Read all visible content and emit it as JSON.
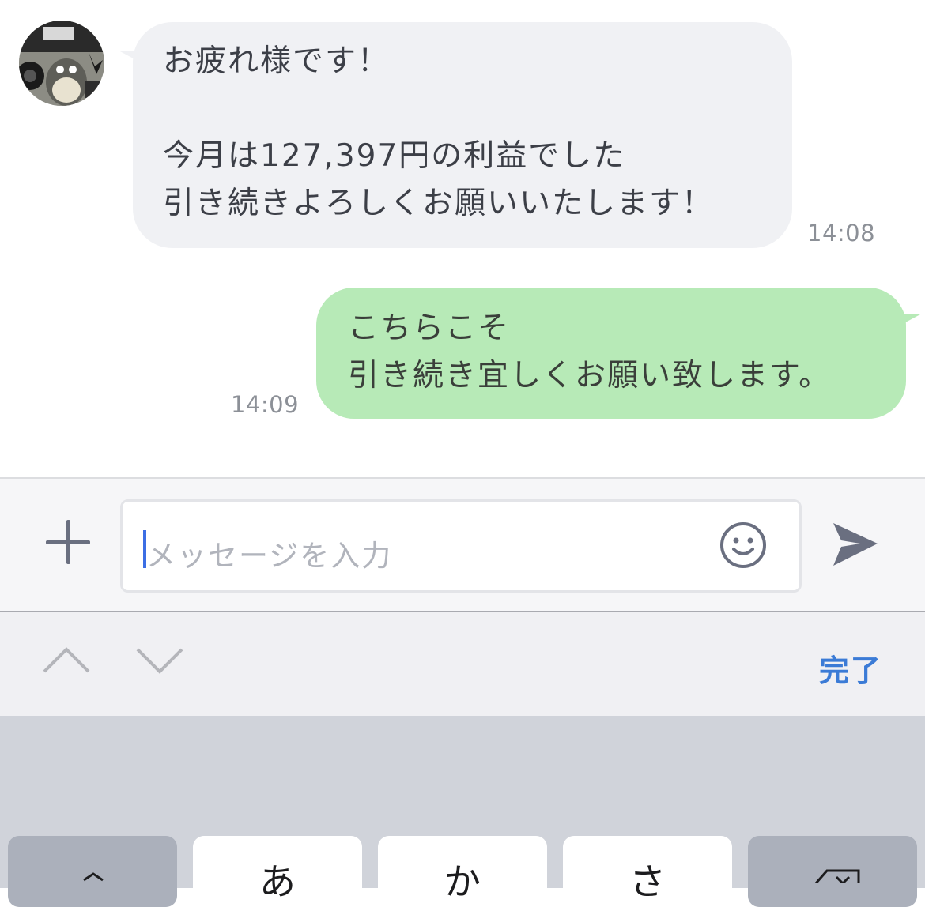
{
  "chat": {
    "incoming": {
      "lines": [
        "お疲れ様です！",
        "",
        "今月は127,397円の利益でした",
        "引き続きよろしくお願いいたします！"
      ],
      "time": "14:08"
    },
    "outgoing": {
      "lines": [
        "こちらこそ",
        "引き続き宜しくお願い致します。"
      ],
      "time": "14:09"
    }
  },
  "input": {
    "placeholder": "メッセージを入力"
  },
  "toolbar": {
    "done_label": "完了"
  },
  "keyboard": {
    "keys": [
      "あ",
      "か",
      "さ"
    ]
  },
  "colors": {
    "incoming_bubble": "#f0f1f4",
    "outgoing_bubble": "#b7eab7",
    "accent": "#3b7bd6",
    "caret": "#3c6ee4"
  },
  "icons": [
    "plus-icon",
    "smiley-icon",
    "send-icon",
    "chevron-up-icon",
    "chevron-down-icon",
    "backspace-icon",
    "avatar-image"
  ]
}
